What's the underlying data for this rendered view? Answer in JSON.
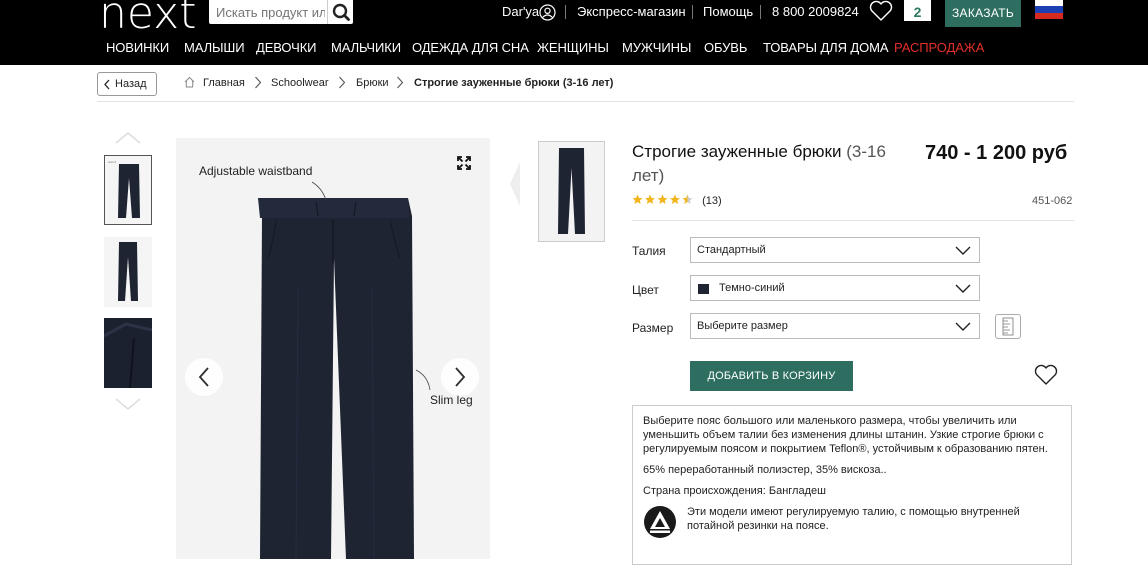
{
  "header": {
    "logo": "next",
    "search_placeholder": "Искать продукт или бренд",
    "user_name": "Dar'ya",
    "express_store": "Экспресс-магазин",
    "help": "Помощь",
    "phone": "8 800 2009824",
    "cart_count": "2",
    "order_button": "ЗАКАЗАТЬ"
  },
  "nav": {
    "items": [
      "НОВИНКИ",
      "МАЛЫШИ",
      "ДЕВОЧКИ",
      "МАЛЬЧИКИ",
      "ОДЕЖДА ДЛЯ СНА",
      "ЖЕНЩИНЫ",
      "МУЖЧИНЫ",
      "ОБУВЬ",
      "ТОВАРЫ ДЛЯ ДОМА",
      "РАСПРОДАЖА"
    ],
    "sale_color": "#e0302a"
  },
  "back_button": "Назад",
  "breadcrumb": [
    "Главная",
    "Schoolwear",
    "Брюки",
    "Строгие зауженные брюки (3-16 лет)"
  ],
  "gallery": {
    "callout_waist": "Adjustable waistband",
    "callout_leg": "Slim leg"
  },
  "product": {
    "title_main": "Строгие зауженные брюки",
    "title_age": "(3-16 лет)",
    "price": "740 - 1 200 руб",
    "rating": 4.5,
    "reviews": "(13)",
    "code": "451-062"
  },
  "options": {
    "waist_label": "Талия",
    "waist_value": "Стандартный",
    "color_label": "Цвет",
    "color_value": "Темно-синий",
    "color_swatch": "#1f2433",
    "size_label": "Размер",
    "size_value": "Выберите размер"
  },
  "add_to_cart": "ДОБАВИТЬ В КОРЗИНУ",
  "description": {
    "text": "Выберите пояс большого или маленького размера, чтобы увеличить или уменьшить объем талии без изменения длины штанин. Узкие строгие брюки с регулируемым поясом и покрытием Teflon®, устойчивым к образованию пятен.",
    "composition": "65% переработанный полиэстер, 35% вискоза..",
    "origin": "Страна происхождения: Бангладеш",
    "waist_note": "Эти модели имеют регулируемую талию, с помощью внутренней потайной резинки на поясе."
  },
  "colors": {
    "brand_green": "#2d6e60",
    "trouser_navy": "#1f2433"
  }
}
